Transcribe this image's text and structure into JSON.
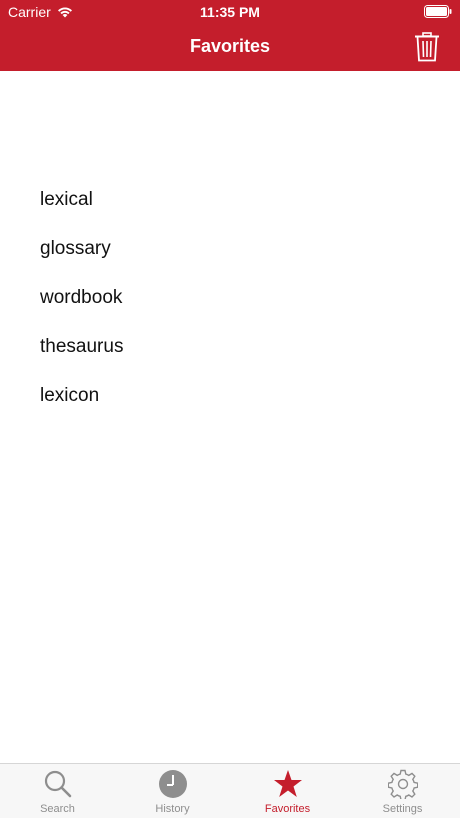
{
  "status_bar": {
    "carrier": "Carrier",
    "time": "11:35 PM"
  },
  "nav": {
    "title": "Favorites"
  },
  "favorites": [
    "lexical",
    "glossary",
    "wordbook",
    "thesaurus",
    "lexicon"
  ],
  "tabs": [
    {
      "label": "Search",
      "icon": "magnifier-icon",
      "active": false
    },
    {
      "label": "History",
      "icon": "clock-icon",
      "active": false
    },
    {
      "label": "Favorites",
      "icon": "star-icon",
      "active": true
    },
    {
      "label": "Settings",
      "icon": "gear-icon",
      "active": false
    }
  ],
  "colors": {
    "accent": "#c41e2c",
    "tab_inactive": "#8e8e8e"
  }
}
